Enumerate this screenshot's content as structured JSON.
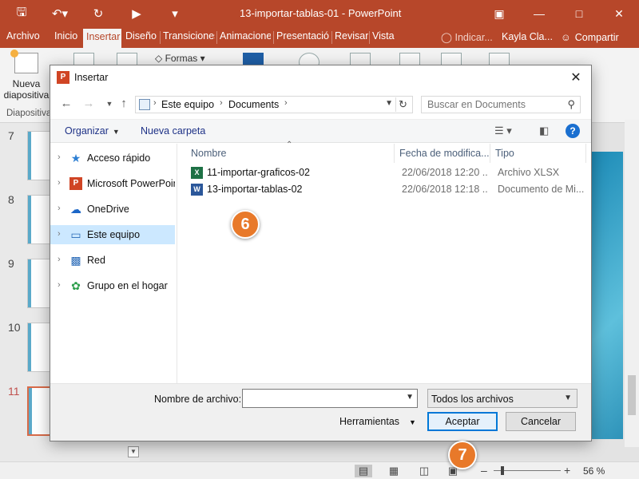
{
  "app": {
    "title": "13-importar-tablas-01 - PowerPoint",
    "accent": "#b7472a"
  },
  "ribbon_tabs": [
    "Archivo",
    "Inicio",
    "Insertar",
    "Diseño",
    "Transiciones",
    "Animaciones",
    "Presentación",
    "Revisar",
    "Vista"
  ],
  "tell_me": "Indicar...",
  "user_name": "Kayla Cla...",
  "share_label": "Compartir",
  "ribbon": {
    "new_slide_label_1": "Nueva",
    "new_slide_label_2": "diapositiva",
    "group_label": "Diapositiva",
    "formas_label": "Formas"
  },
  "slides": [
    {
      "number": "7"
    },
    {
      "number": "8"
    },
    {
      "number": "9"
    },
    {
      "number": "10"
    },
    {
      "number": "11",
      "active": true
    }
  ],
  "statusbar": {
    "zoom": "56 %",
    "zoom_fraction": 0.56
  },
  "dialog": {
    "title": "Insertar",
    "address": [
      "Este equipo",
      "Documents"
    ],
    "search_placeholder": "Buscar en Documents",
    "organize_label": "Organizar",
    "new_folder_label": "Nueva carpeta",
    "nav_items": [
      {
        "label": "Acceso rápido",
        "icon": "star-icon",
        "selected": false
      },
      {
        "label": "Microsoft PowerPoint",
        "icon": "powerpoint-icon",
        "selected": false
      },
      {
        "label": "OneDrive",
        "icon": "cloud-icon",
        "selected": false
      },
      {
        "label": "Este equipo",
        "icon": "computer-icon",
        "selected": true
      },
      {
        "label": "Red",
        "icon": "network-icon",
        "selected": false
      },
      {
        "label": "Grupo en el hogar",
        "icon": "homegroup-icon",
        "selected": false
      }
    ],
    "columns": {
      "name": "Nombre",
      "date": "Fecha de modifica...",
      "type": "Tipo"
    },
    "files": [
      {
        "name": "11-importar-graficos-02",
        "date": "22/06/2018 12:20 ...",
        "type": "Archivo XLSX",
        "icon": "excel-icon"
      },
      {
        "name": "13-importar-tablas-02",
        "date": "22/06/2018 12:18 ...",
        "type": "Documento de Mi...",
        "icon": "word-icon"
      }
    ],
    "filename_label": "Nombre de archivo:",
    "filename_value": "",
    "filter_value": "Todos los archivos",
    "tools_label": "Herramientas",
    "accept_label": "Aceptar",
    "cancel_label": "Cancelar"
  },
  "callouts": [
    "6",
    "7"
  ]
}
